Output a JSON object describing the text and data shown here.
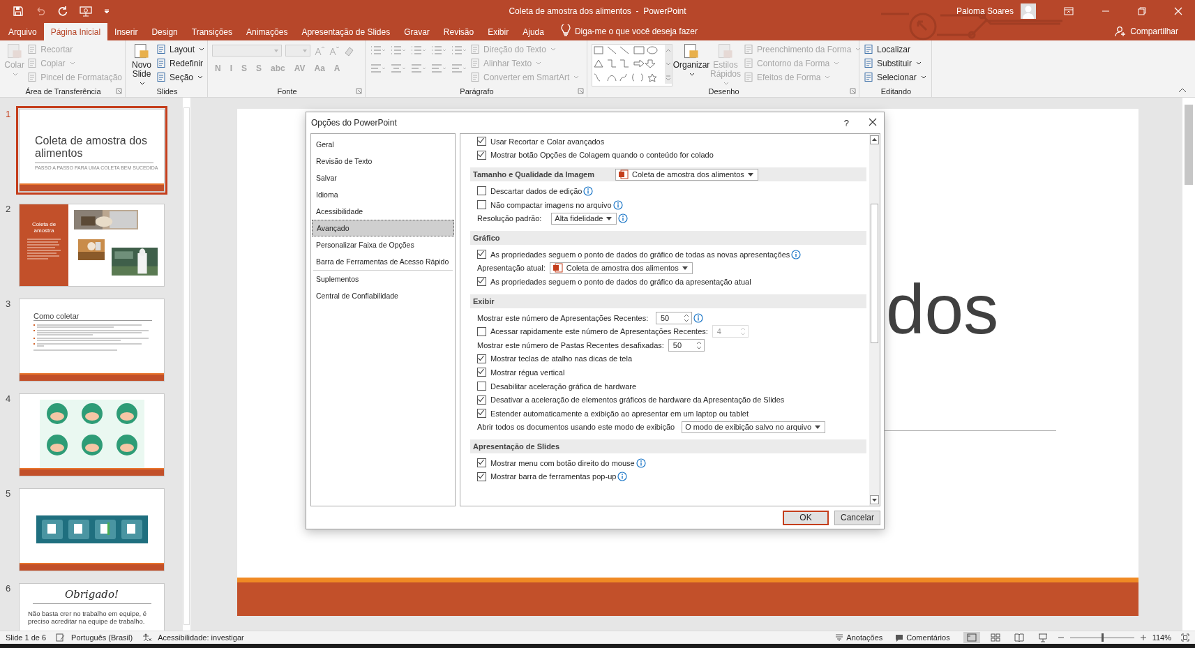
{
  "window": {
    "title": "Coleta de amostra dos alimentos  -  PowerPoint",
    "user": "Paloma Soares"
  },
  "ribbon_tabs": [
    {
      "label": "Arquivo",
      "selected": false
    },
    {
      "label": "Página Inicial",
      "selected": true
    },
    {
      "label": "Inserir",
      "selected": false
    },
    {
      "label": "Design",
      "selected": false
    },
    {
      "label": "Transições",
      "selected": false
    },
    {
      "label": "Animações",
      "selected": false
    },
    {
      "label": "Apresentação de Slides",
      "selected": false
    },
    {
      "label": "Gravar",
      "selected": false
    },
    {
      "label": "Revisão",
      "selected": false
    },
    {
      "label": "Exibir",
      "selected": false
    },
    {
      "label": "Ajuda",
      "selected": false
    }
  ],
  "tell_me": "Diga-me o que você deseja fazer",
  "share": "Compartilhar",
  "ribbon_groups": [
    {
      "label": "Área de Transferência",
      "launcher": true,
      "columns": [
        {
          "kind": "large",
          "label": "Colar",
          "disabled": true,
          "dropdown": true
        },
        {
          "kind": "stack",
          "items": [
            {
              "label": "Recortar",
              "disabled": true,
              "dropdown": false
            },
            {
              "label": "Copiar",
              "disabled": true,
              "dropdown": true
            },
            {
              "label": "Pincel de Formatação",
              "disabled": true,
              "dropdown": false
            }
          ]
        }
      ]
    },
    {
      "label": "Slides",
      "launcher": false,
      "columns": [
        {
          "kind": "large",
          "label": "Novo Slide",
          "disabled": false,
          "dropdown": true
        },
        {
          "kind": "stack",
          "items": [
            {
              "label": "Layout",
              "disabled": false,
              "dropdown": true
            },
            {
              "label": "Redefinir",
              "disabled": false,
              "dropdown": false
            },
            {
              "label": "Seção",
              "disabled": false,
              "dropdown": true
            }
          ]
        }
      ]
    },
    {
      "label": "Fonte",
      "launcher": true,
      "columns": [
        {
          "kind": "font",
          "formats": [
            "N",
            "I",
            "S",
            "S",
            "abc",
            "AV",
            "Aa",
            "A"
          ]
        }
      ]
    },
    {
      "label": "Parágrafo",
      "launcher": true,
      "columns": [
        {
          "kind": "paragraph"
        },
        {
          "kind": "stack",
          "items": [
            {
              "label": "Direção do Texto",
              "disabled": true,
              "dropdown": true
            },
            {
              "label": "Alinhar Texto",
              "disabled": true,
              "dropdown": true
            },
            {
              "label": "Converter em SmartArt",
              "disabled": true,
              "dropdown": true
            }
          ]
        }
      ]
    },
    {
      "label": "Desenho",
      "launcher": true,
      "columns": [
        {
          "kind": "shapes"
        },
        {
          "kind": "large",
          "label": "Organizar",
          "disabled": false,
          "dropdown": true
        },
        {
          "kind": "large",
          "label": "Estilos Rápidos",
          "disabled": true,
          "dropdown": true
        },
        {
          "kind": "stack",
          "items": [
            {
              "label": "Preenchimento da Forma",
              "disabled": true,
              "dropdown": true
            },
            {
              "label": "Contorno da Forma",
              "disabled": true,
              "dropdown": true
            },
            {
              "label": "Efeitos de Forma",
              "disabled": true,
              "dropdown": true
            }
          ]
        }
      ]
    },
    {
      "label": "Editando",
      "launcher": false,
      "columns": [
        {
          "kind": "stack",
          "items": [
            {
              "label": "Localizar",
              "disabled": false,
              "dropdown": false
            },
            {
              "label": "Substituir",
              "disabled": false,
              "dropdown": true
            },
            {
              "label": "Selecionar",
              "disabled": false,
              "dropdown": true
            }
          ]
        }
      ]
    }
  ],
  "slides": [
    {
      "number": "1",
      "selected": true,
      "kind": "title",
      "title": "Coleta de amostra dos alimentos",
      "subtitle": "PASSO A PASSO PARA UMA COLETA BEM SUCEDIDA"
    },
    {
      "number": "2",
      "selected": false,
      "kind": "sidebar-photos",
      "title": "Coleta de amostra"
    },
    {
      "number": "3",
      "selected": false,
      "kind": "bullets",
      "title": "Como coletar"
    },
    {
      "number": "4",
      "selected": false,
      "kind": "illustration"
    },
    {
      "number": "5",
      "selected": false,
      "kind": "banner"
    },
    {
      "number": "6",
      "selected": false,
      "kind": "quote",
      "title": "Obrigado!",
      "text": "Não basta crer no trabalho em equipe, é preciso acreditar na equipe de trabalho."
    }
  ],
  "editor": {
    "visible_title": "dos"
  },
  "dialog": {
    "title": "Opções do PowerPoint",
    "help": "?",
    "nav": [
      {
        "label": "Geral",
        "selected": false
      },
      {
        "label": "Revisão de Texto",
        "selected": false
      },
      {
        "label": "Salvar",
        "selected": false
      },
      {
        "label": "Idioma",
        "selected": false
      },
      {
        "label": "Acessibilidade",
        "selected": false
      },
      {
        "label": "Avançado",
        "selected": true
      },
      {
        "label": "Personalizar Faixa de Opções",
        "selected": false
      },
      {
        "label": "Barra de Ferramentas de Acesso Rápido",
        "selected": false
      },
      {
        "label": "Suplementos",
        "selected": false,
        "divider_before": true
      },
      {
        "label": "Central de Confiabilidade",
        "selected": false
      }
    ],
    "rows": [
      {
        "kind": "check",
        "label": "Usar Recortar e Colar avançados",
        "checked": true
      },
      {
        "kind": "check",
        "label": "Mostrar botão Opções de Colagem quando o conteúdo for colado",
        "checked": true
      },
      {
        "kind": "section",
        "label": "Tamanho e Qualidade da Imagem",
        "select": {
          "kind": "file",
          "value": "Coleta de amostra dos alimentos"
        }
      },
      {
        "kind": "check",
        "label": "Descartar dados de edição",
        "checked": false,
        "info": true
      },
      {
        "kind": "check",
        "label": "Não compactar imagens no arquivo",
        "checked": false,
        "info": true
      },
      {
        "kind": "field",
        "label": "Resolução padrão:",
        "info": true,
        "select": {
          "kind": "plain",
          "value": "Alta fidelidade"
        }
      },
      {
        "kind": "section",
        "label": "Gráfico"
      },
      {
        "kind": "check",
        "label": "As propriedades seguem o ponto de dados do gráfico de todas as novas apresentações",
        "checked": true,
        "info": true
      },
      {
        "kind": "field",
        "label": "Apresentação atual:",
        "select": {
          "kind": "file",
          "value": "Coleta de amostra dos alimentos"
        }
      },
      {
        "kind": "check",
        "label": "As propriedades seguem o ponto de dados do gráfico da apresentação atual",
        "checked": true
      },
      {
        "kind": "section",
        "label": "Exibir"
      },
      {
        "kind": "field",
        "label": "Mostrar este número de Apresentações Recentes:",
        "spin": {
          "value": "50",
          "disabled": false
        },
        "info": true
      },
      {
        "kind": "check",
        "label": "Acessar rapidamente este número de Apresentações Recentes:",
        "checked": false,
        "spin": {
          "value": "4",
          "disabled": true
        }
      },
      {
        "kind": "field",
        "label": "Mostrar este número de Pastas Recentes desafixadas:",
        "spin": {
          "value": "50",
          "disabled": false
        }
      },
      {
        "kind": "check",
        "label": "Mostrar teclas de atalho nas dicas de tela",
        "checked": true
      },
      {
        "kind": "check",
        "label": "Mostrar régua vertical",
        "checked": true
      },
      {
        "kind": "check",
        "label": "Desabilitar aceleração gráfica de hardware",
        "checked": false
      },
      {
        "kind": "check",
        "label": "Desativar a aceleração de elementos gráficos de hardware da Apresentação de Slides",
        "checked": true
      },
      {
        "kind": "check",
        "label": "Estender automaticamente a exibição ao apresentar em um laptop ou tablet",
        "checked": true
      },
      {
        "kind": "field",
        "label": "Abrir todos os documentos usando este modo de exibição",
        "select": {
          "kind": "wide",
          "value": "O modo de exibição salvo no arquivo"
        }
      },
      {
        "kind": "section",
        "label": "Apresentação de Slides"
      },
      {
        "kind": "check",
        "label": "Mostrar menu com botão direito do mouse",
        "checked": true,
        "info": true
      },
      {
        "kind": "check",
        "label": "Mostrar barra de ferramentas pop-up",
        "checked": true,
        "info": true
      }
    ],
    "buttons": [
      {
        "label": "OK",
        "default": true
      },
      {
        "label": "Cancelar",
        "default": false
      }
    ]
  },
  "status_bar": {
    "slide": "Slide 1 de 6",
    "language": "Português (Brasil)",
    "accessibility": "Acessibilidade: investigar",
    "notes": "Anotações",
    "comments": "Comentários",
    "zoom": "114%",
    "zoom_slider": {
      "level": 0.5
    }
  }
}
